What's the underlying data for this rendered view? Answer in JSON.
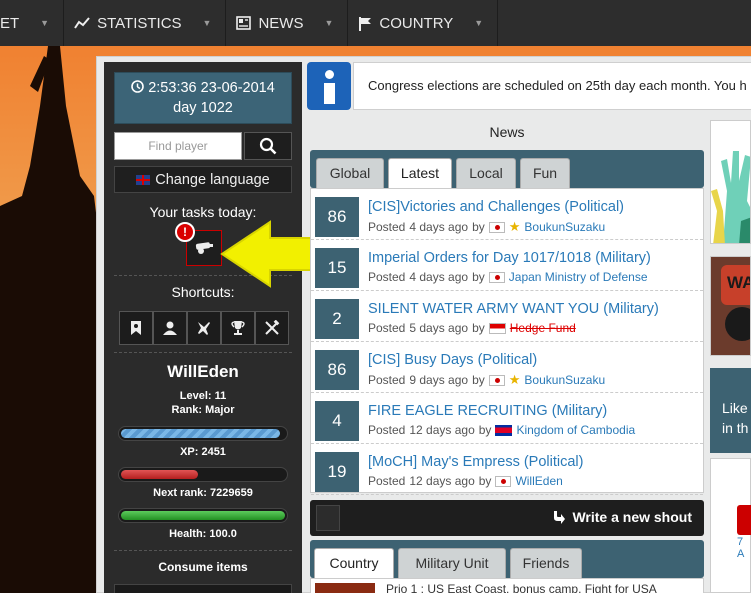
{
  "nav": {
    "items": [
      {
        "label": "ET",
        "icon": "market-icon"
      },
      {
        "label": "STATISTICS",
        "icon": "chart-icon"
      },
      {
        "label": "NEWS",
        "icon": "newspaper-icon"
      },
      {
        "label": "COUNTRY",
        "icon": "flag-icon"
      }
    ]
  },
  "sidebar": {
    "clock_time": "2:53:36 23-06-2014",
    "clock_day": "day 1022",
    "find_placeholder": "Find player",
    "change_language": "Change language",
    "tasks_label": "Your tasks today:",
    "warning_mark": "!",
    "shortcuts_label": "Shortcuts:",
    "username": "WillEden",
    "level": "Level: 11",
    "rank": "Rank: Major",
    "xp_label": "XP:  2451",
    "xp_progress": 0.97,
    "next_rank": "Next rank:  7229659",
    "next_rank_progress": 0.47,
    "health": "Health:  100.0",
    "health_progress": 1.0,
    "consume_label": "Consume items"
  },
  "info": {
    "text": "Congress elections are scheduled on 25th day each month. You h"
  },
  "news": {
    "title": "News",
    "tabs": [
      "Global",
      "Latest",
      "Local",
      "Fun"
    ],
    "active_tab": "Latest",
    "posted_label": "Posted",
    "by_label": "by",
    "items": [
      {
        "count": "86",
        "title": "[CIS]Victories and Challenges (Political)",
        "ago": "4 days ago",
        "author": "BoukunSuzaku",
        "flag": "jp",
        "star": true,
        "struck": false
      },
      {
        "count": "15",
        "title": "Imperial Orders for Day 1017/1018 (Military)",
        "ago": "4 days ago",
        "author": "Japan Ministry of Defense",
        "flag": "jp",
        "star": false,
        "struck": false
      },
      {
        "count": "2",
        "title": "SILENT WATER ARMY WANT YOU (Military)",
        "ago": "5 days ago",
        "author": "Hedge Fund",
        "flag": "id",
        "star": false,
        "struck": true
      },
      {
        "count": "86",
        "title": "[CIS] Busy Days (Political)",
        "ago": "9 days ago",
        "author": "BoukunSuzaku",
        "flag": "jp",
        "star": true,
        "struck": false
      },
      {
        "count": "4",
        "title": "FIRE EAGLE RECRUITING (Military)",
        "ago": "12 days ago",
        "author": "Kingdom of Cambodia",
        "flag": "kh",
        "star": false,
        "struck": false
      },
      {
        "count": "19",
        "title": "[MoCH] May's Empress (Political)",
        "ago": "12 days ago",
        "author": "WillEden",
        "flag": "jp",
        "star": false,
        "struck": false
      }
    ]
  },
  "shout": {
    "write_label": "Write a new shout",
    "tabs": [
      "Country",
      "Military Unit",
      "Friends"
    ],
    "active_tab": "Country",
    "preview": "Prio 1 : US East Coast, bonus camp. Fight for USA"
  },
  "right": {
    "like_label1": "Like",
    "like_label2": "in th",
    "partial_badge": "WA",
    "partial_link": "7 A"
  },
  "colors": {
    "accent": "#3d6272",
    "link": "#2a7ab8",
    "arrow": "#f2f000"
  }
}
